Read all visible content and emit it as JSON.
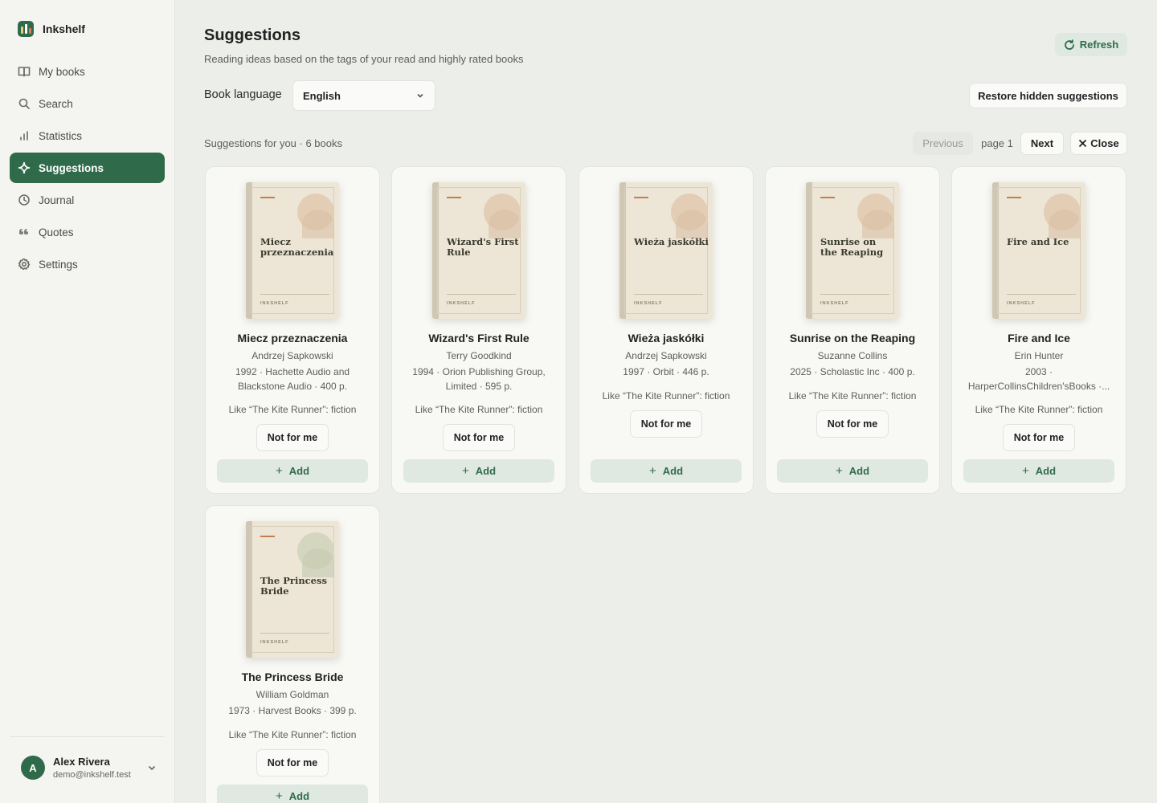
{
  "app": {
    "name": "Inkshelf"
  },
  "sidebar": {
    "items": [
      {
        "label": "My books",
        "icon": "book-open-icon"
      },
      {
        "label": "Search",
        "icon": "search-icon"
      },
      {
        "label": "Statistics",
        "icon": "bar-chart-icon"
      },
      {
        "label": "Suggestions",
        "icon": "sparkle-icon",
        "active": true
      },
      {
        "label": "Journal",
        "icon": "clock-icon"
      },
      {
        "label": "Quotes",
        "icon": "quote-icon"
      },
      {
        "label": "Settings",
        "icon": "gear-icon"
      }
    ],
    "user": {
      "initial": "A",
      "name": "Alex Rivera",
      "email": "demo@inkshelf.test"
    }
  },
  "header": {
    "title": "Suggestions",
    "subtitle": "Reading ideas based on the tags of your read and highly rated books",
    "refresh_label": "Refresh"
  },
  "filters": {
    "language_label": "Book language",
    "language_value": "English",
    "restore_label": "Restore hidden suggestions"
  },
  "results": {
    "count_text": "Suggestions for you · 6 books",
    "previous_label": "Previous",
    "page_label": "page 1",
    "next_label": "Next",
    "close_label": "Close"
  },
  "cover_brand": "INKSHELF",
  "books": [
    {
      "cover_title": "Miecz przeznaczenia",
      "title": "Miecz przeznaczenia",
      "author": "Andrzej Sapkowski",
      "meta": "1992 · Hachette Audio and Blackstone Audio · 400 p.",
      "reason": "Like “The Kite Runner”: fiction",
      "not_for_me": "Not for me",
      "add": "Add"
    },
    {
      "cover_title": "Wizard's First Rule",
      "title": "Wizard's First Rule",
      "author": "Terry Goodkind",
      "meta": "1994 · Orion Publishing Group, Limited · 595 p.",
      "reason": "Like “The Kite Runner”: fiction",
      "not_for_me": "Not for me",
      "add": "Add"
    },
    {
      "cover_title": "Wieża jaskółki",
      "title": "Wieża jaskółki",
      "author": "Andrzej Sapkowski",
      "meta": "1997 · Orbit · 446 p.",
      "reason": "Like “The Kite Runner”: fiction",
      "not_for_me": "Not for me",
      "add": "Add"
    },
    {
      "cover_title": "Sunrise on the Reaping",
      "title": "Sunrise on the Reaping",
      "author": "Suzanne Collins",
      "meta": "2025 · Scholastic Inc · 400 p.",
      "reason": "Like “The Kite Runner”: fiction",
      "not_for_me": "Not for me",
      "add": "Add"
    },
    {
      "cover_title": "Fire and Ice",
      "title": "Fire and Ice",
      "author": "Erin Hunter",
      "meta_line1": "2003 ·",
      "meta_line2": "HarperCollinsChildren'sBooks ·...",
      "reason": "Like “The Kite Runner”: fiction",
      "not_for_me": "Not for me",
      "add": "Add"
    },
    {
      "cover_title": "The Princess Bride",
      "title": "The Princess Bride",
      "author": "William Goldman",
      "meta": "1973 · Harvest Books · 399 p.",
      "reason": "Like “The Kite Runner”: fiction",
      "not_for_me": "Not for me",
      "add": "Add"
    }
  ],
  "colors": {
    "accent": "#2f6b4a",
    "accent_soft": "#dfe8e1",
    "background": "#eceee9",
    "sidebar": "#f4f4f1",
    "card": "#f8f8f5"
  }
}
